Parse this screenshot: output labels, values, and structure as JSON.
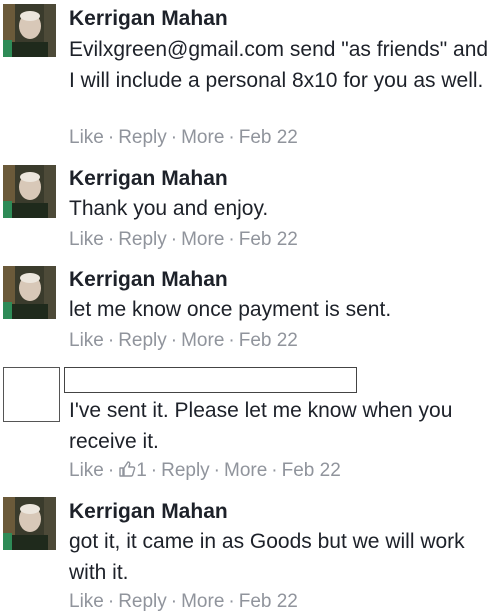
{
  "comments": [
    {
      "author": "Kerrigan Mahan",
      "text": "Evilxgreen@gmail.com send \"as friends\" and I will include a personal 8x10 for you as well.",
      "actions": {
        "like": "Like",
        "reply": "Reply",
        "more": "More",
        "date": "Feb 22"
      }
    },
    {
      "author": "Kerrigan Mahan",
      "text": "Thank you and enjoy.",
      "actions": {
        "like": "Like",
        "reply": "Reply",
        "more": "More",
        "date": "Feb 22"
      }
    },
    {
      "author": "Kerrigan Mahan",
      "text": "let me know once payment is sent.",
      "actions": {
        "like": "Like",
        "reply": "Reply",
        "more": "More",
        "date": "Feb 22"
      }
    },
    {
      "author": "",
      "text": "I've sent it. Please let me know when you receive it.",
      "actions": {
        "like": "Like",
        "like_count": "1",
        "reply": "Reply",
        "more": "More",
        "date": "Feb 22"
      }
    },
    {
      "author": "Kerrigan Mahan",
      "text": "got it, it came in as Goods but we will work with it.",
      "actions": {
        "like": "Like",
        "reply": "Reply",
        "more": "More",
        "date": "Feb 22"
      }
    }
  ],
  "colors": {
    "text": "#1d2129",
    "meta": "#90949c",
    "like_icon": "#90949c"
  }
}
